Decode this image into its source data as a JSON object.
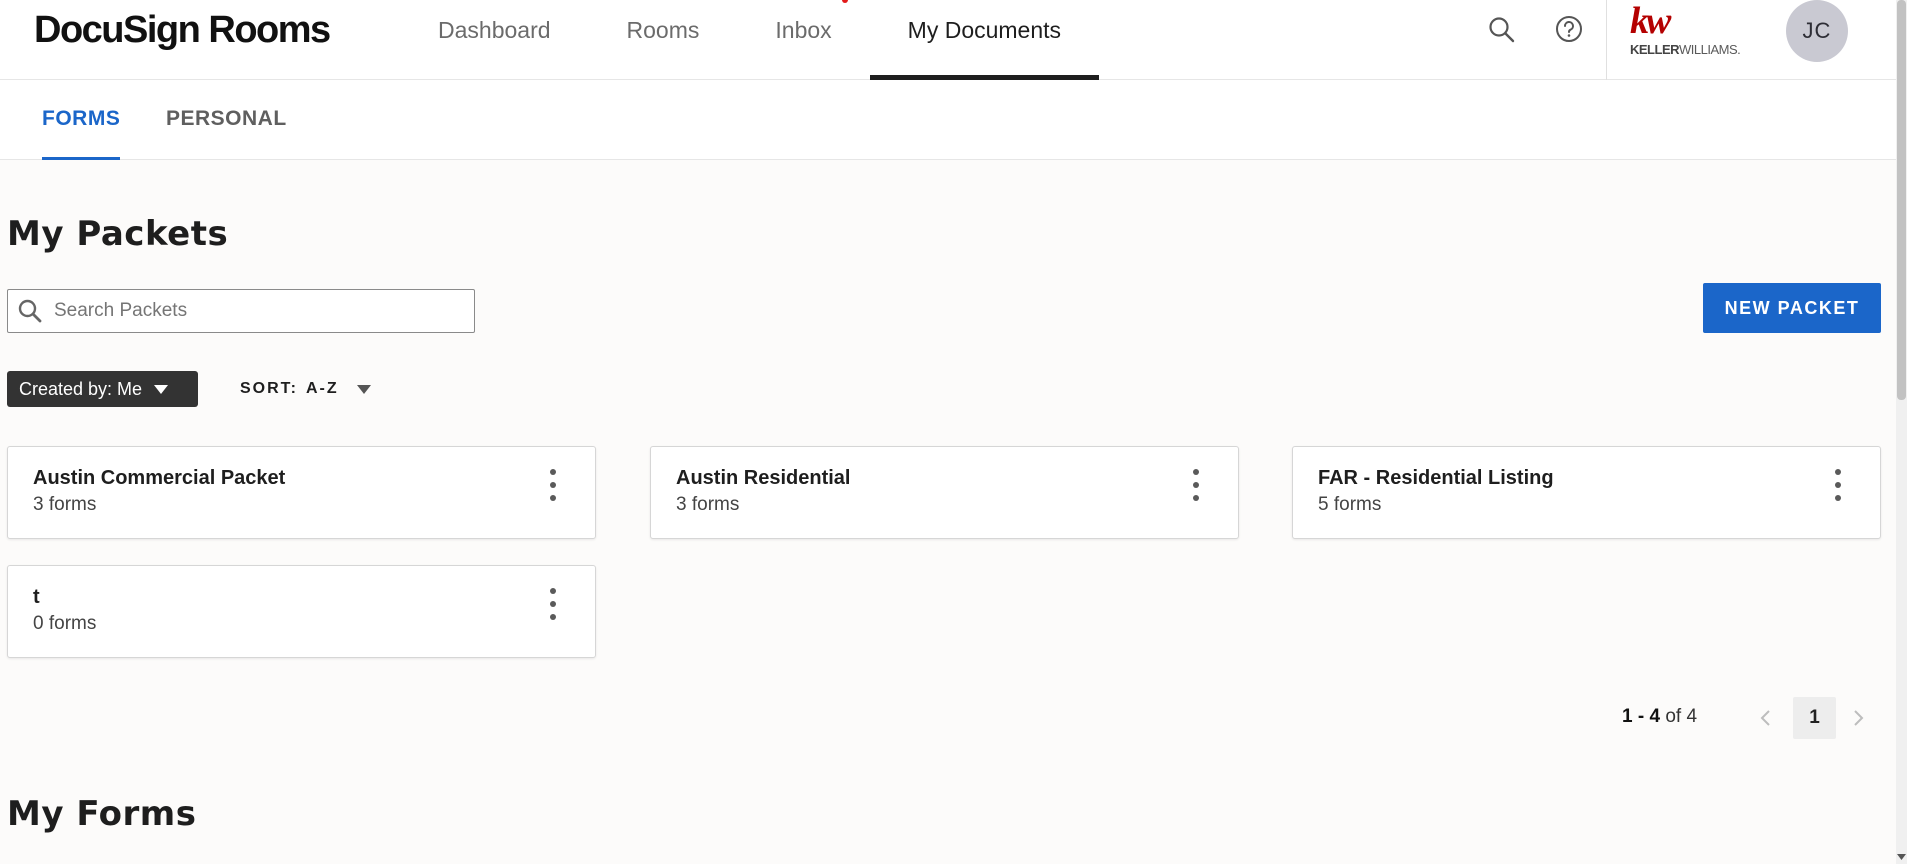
{
  "header": {
    "logo": "DocuSign Rooms",
    "nav": [
      {
        "label": "Dashboard"
      },
      {
        "label": "Rooms"
      },
      {
        "label": "Inbox"
      },
      {
        "label": "My Documents"
      }
    ],
    "brand_mark": "kw",
    "brand_text_bold": "KELLER",
    "brand_text_rest": "WILLIAMS.",
    "avatar_initials": "JC",
    "icons": [
      "search-icon",
      "help-icon"
    ]
  },
  "subtabs": [
    {
      "label": "FORMS",
      "active": true
    },
    {
      "label": "PERSONAL",
      "active": false
    }
  ],
  "packets": {
    "title": "My Packets",
    "search_placeholder": "Search Packets",
    "new_button": "NEW PACKET",
    "filter_label": "Created by: Me",
    "sort_label": "SORT:",
    "sort_value": "A-Z",
    "cards": [
      {
        "name": "Austin Commercial Packet",
        "count": "3 forms"
      },
      {
        "name": "Austin Residential",
        "count": "3 forms"
      },
      {
        "name": "FAR - Residential Listing",
        "count": "5 forms"
      },
      {
        "name": "t",
        "count": "0 forms"
      }
    ],
    "pager": {
      "range": "1 - 4",
      "of": "of",
      "total": "4",
      "current_page": "1"
    }
  },
  "forms": {
    "title": "My Forms"
  },
  "colors": {
    "accent": "#1b66c9",
    "brand_red": "#b40101",
    "chip_bg": "#333333"
  }
}
